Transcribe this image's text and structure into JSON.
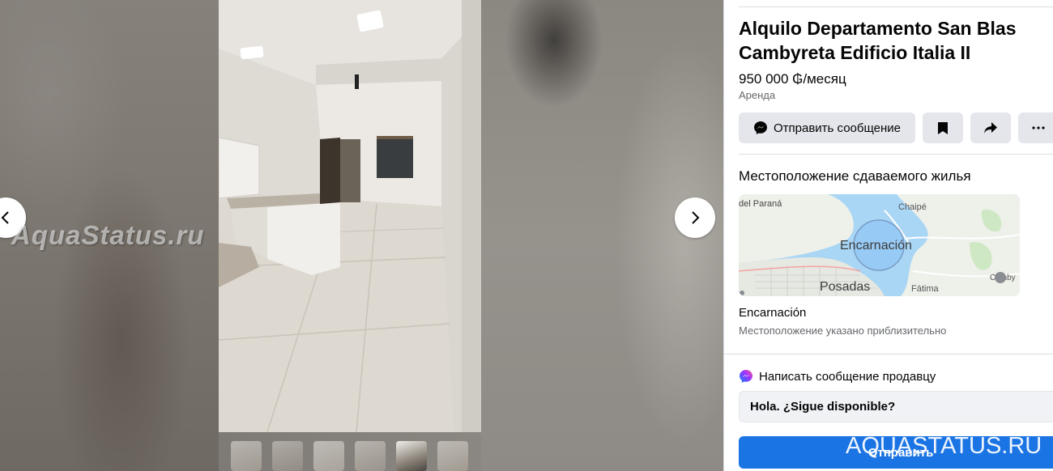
{
  "listing": {
    "title": "Alquilo Departamento San Blas Cambyreta Edificio Italia II",
    "price": "950 000 ₲/месяц",
    "category": "Аренда"
  },
  "actions": {
    "message_label": "Отправить сообщение",
    "save_icon": "bookmark-icon",
    "share_icon": "share-arrow-icon",
    "more_icon": "more-dots-icon",
    "message_icon": "messenger-icon"
  },
  "location": {
    "heading": "Местоположение сдаваемого жилья",
    "name": "Encarnación",
    "note": "Местоположение указано приблизительно",
    "map_labels": {
      "city_main": "Encarnación",
      "city_posadas": "Posadas",
      "place_chaipe": "Chaipé",
      "place_fatima": "Fátima",
      "place_parana": "del Paraná",
      "place_camby": "Camby"
    }
  },
  "seller_message": {
    "heading": "Написать сообщение продавцу",
    "input_value": "Hola. ¿Sigue disponible?",
    "send_label": "Отправить"
  },
  "watermarks": {
    "left": "AquaStatus.ru",
    "right": "AQUASTATUS.RU"
  },
  "gallery": {
    "thumbnail_count": 6,
    "active_thumbnail": 5
  },
  "colors": {
    "primary_button": "#1b74e4",
    "secondary_button": "#e4e6eb",
    "text_primary": "#050505",
    "text_secondary": "#65676b",
    "map_water": "#a9d6f5"
  }
}
